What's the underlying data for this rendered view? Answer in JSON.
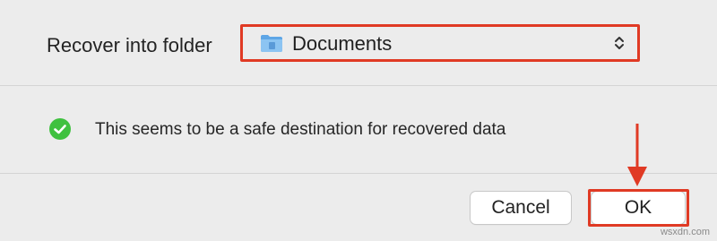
{
  "dialog": {
    "recover_label": "Recover into folder",
    "folder_select": {
      "value": "Documents",
      "icon": "folder-icon"
    },
    "status_icon": "checkmark-circle-icon",
    "status_text": "This seems to be a safe destination for recovered data",
    "cancel_label": "Cancel",
    "ok_label": "OK"
  },
  "colors": {
    "highlight": "#e03a24",
    "success": "#3fc13f",
    "folder": "#6aaee8"
  },
  "watermark": "wsxdn.com"
}
